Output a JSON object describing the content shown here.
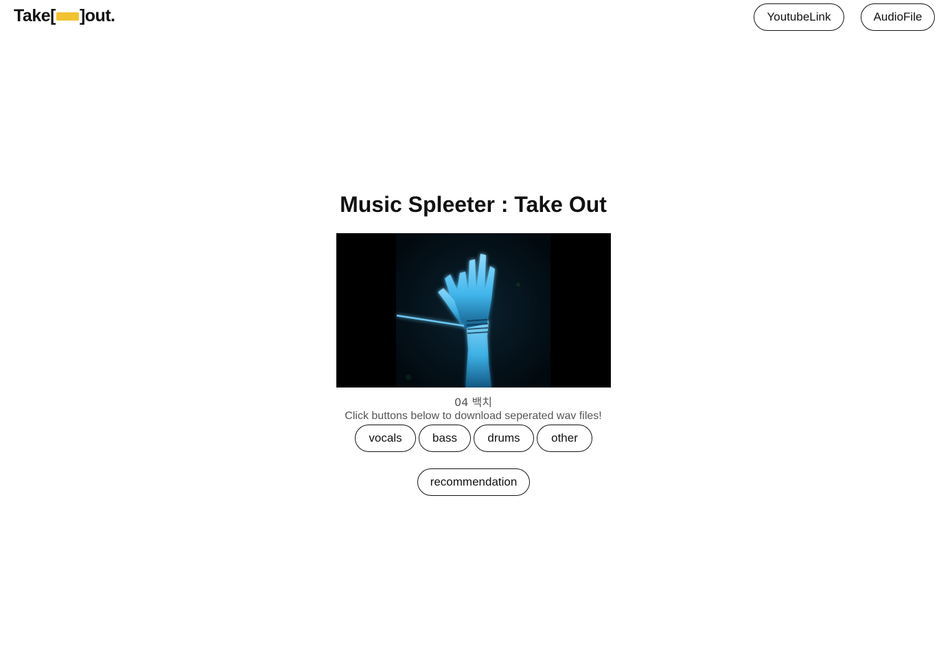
{
  "header": {
    "logo": {
      "prefix": "Take[",
      "suffix": "]out.",
      "accent_color": "#f2c230"
    },
    "nav": {
      "youtube_label": "YoutubeLink",
      "audio_label": "AudioFile"
    }
  },
  "main": {
    "title": "Music Spleeter : Take Out",
    "cover_image": {
      "description_icon": "album-cover-glowing-hand",
      "colors": {
        "background": "#000000",
        "glow": "#3fb4ea"
      }
    },
    "song_title": "04 백치",
    "instruction": "Click buttons below to download seperated wav files!",
    "stems": {
      "vocals": "vocals",
      "bass": "bass",
      "drums": "drums",
      "other": "other"
    },
    "recommendation_label": "recommendation"
  }
}
